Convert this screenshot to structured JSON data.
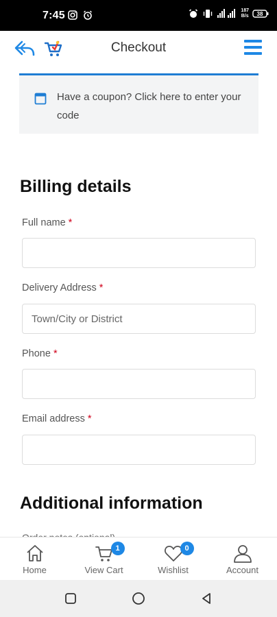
{
  "status_bar": {
    "time": "7:45",
    "net_speed_top": "187",
    "net_speed_bottom": "B/s",
    "battery_percent": "38"
  },
  "header": {
    "title": "Checkout"
  },
  "coupon": {
    "text": "Have a coupon? Click here to enter your code"
  },
  "billing": {
    "title": "Billing details",
    "required_mark": "*",
    "fields": [
      {
        "label": "Full name",
        "value": "",
        "placeholder": ""
      },
      {
        "label": "Delivery Address",
        "value": "",
        "placeholder": "Town/City or District"
      },
      {
        "label": "Phone",
        "value": "",
        "placeholder": ""
      },
      {
        "label": "Email address",
        "value": "",
        "placeholder": ""
      }
    ]
  },
  "additional": {
    "title": "Additional information",
    "first_label": "Order notes (optional)"
  },
  "bottom_nav": {
    "items": [
      {
        "label": "Home",
        "icon": "home-icon"
      },
      {
        "label": "View Cart",
        "icon": "cart-icon",
        "badge": "1"
      },
      {
        "label": "Wishlist",
        "icon": "heart-icon",
        "badge": "0"
      },
      {
        "label": "Account",
        "icon": "user-icon"
      }
    ]
  },
  "colors": {
    "accent": "#1e88e5",
    "required": "#d0021b",
    "coupon_bg": "#f3f4f5"
  }
}
